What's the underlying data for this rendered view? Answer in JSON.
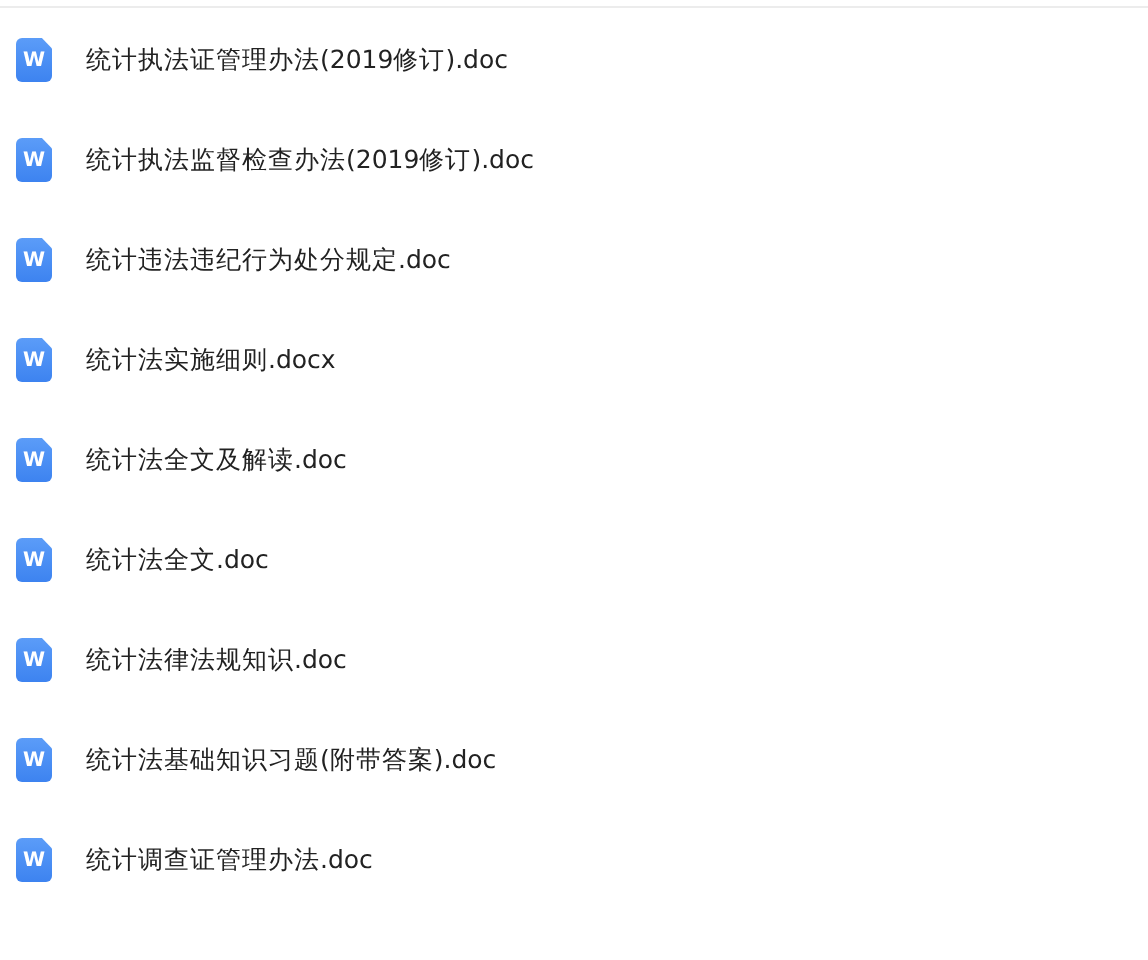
{
  "files": [
    {
      "name": "统计执法证管理办法(2019修订).doc",
      "icon_letter": "W"
    },
    {
      "name": "统计执法监督检查办法(2019修订).doc",
      "icon_letter": "W"
    },
    {
      "name": "统计违法违纪行为处分规定.doc",
      "icon_letter": "W"
    },
    {
      "name": "统计法实施细则.docx",
      "icon_letter": "W"
    },
    {
      "name": "统计法全文及解读.doc",
      "icon_letter": "W"
    },
    {
      "name": "统计法全文.doc",
      "icon_letter": "W"
    },
    {
      "name": "统计法律法规知识.doc",
      "icon_letter": "W"
    },
    {
      "name": "统计法基础知识习题(附带答案).doc",
      "icon_letter": "W"
    },
    {
      "name": "统计调查证管理办法.doc",
      "icon_letter": "W"
    }
  ]
}
